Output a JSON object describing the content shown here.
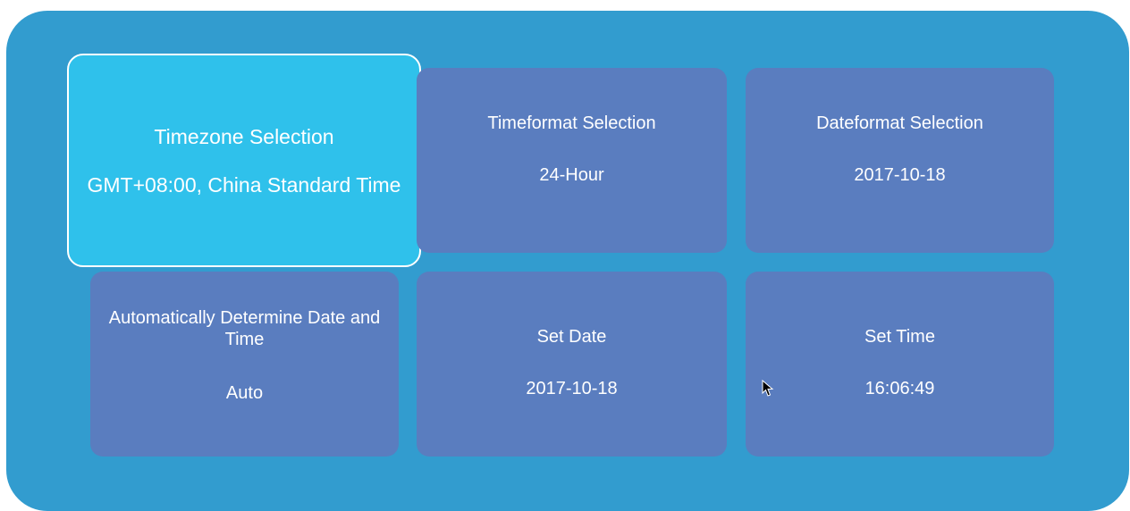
{
  "tiles": [
    {
      "title": "Timezone Selection",
      "value": "GMT+08:00, China Standard Time",
      "selected": true
    },
    {
      "title": "Timeformat Selection",
      "value": "24-Hour",
      "selected": false
    },
    {
      "title": "Dateformat Selection",
      "value": "2017-10-18",
      "selected": false
    },
    {
      "title": "Automatically Determine Date and Time",
      "value": "Auto",
      "selected": false
    },
    {
      "title": "Set Date",
      "value": "2017-10-18",
      "selected": false
    },
    {
      "title": "Set Time",
      "value": "16:06:49",
      "selected": false
    }
  ],
  "colors": {
    "panel_background": "#329ccf",
    "tile_background": "#5a7dbf",
    "tile_selected_background": "#2fc1eb",
    "text": "#ffffff"
  },
  "icons": {
    "cursor": "mouse-pointer-icon"
  }
}
